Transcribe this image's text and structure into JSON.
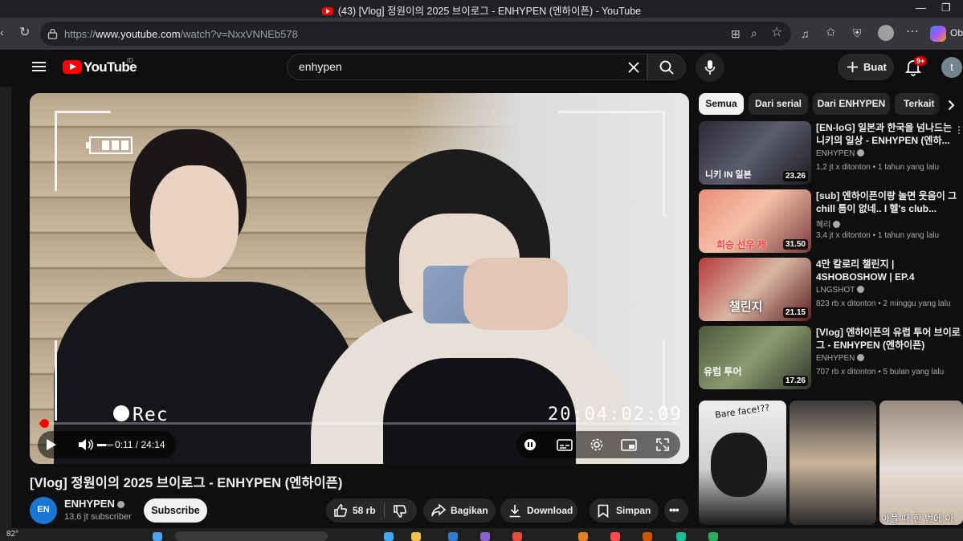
{
  "window": {
    "title": "(43) [Vlog] 정원이의 2025 브이로그 - ENHYPEN (엔하이픈) - YouTube",
    "url_prefix": "https://",
    "url_host": "www.youtube.com",
    "url_path": "/watch?v=NxxVNNEb578",
    "copilot_label": "Ob"
  },
  "header": {
    "logo_text": "YouTube",
    "logo_country": "ID",
    "search_value": "enhypen",
    "create_label": "Buat",
    "notification_count": "9+",
    "avatar_initial": "t"
  },
  "player": {
    "rec_label": "Rec",
    "timecode": "20:04:02:09",
    "current_time": "0:11",
    "duration": "24:14",
    "time_display": "0:11 / 24:14",
    "progress_fraction": 0.0076,
    "volume_fraction": 0.55
  },
  "video": {
    "title": "[Vlog] 정원이의 2025 브이로그 - ENHYPEN (엔하이픈)",
    "channel_name": "ENHYPEN",
    "channel_logo": "EN",
    "subscribers": "13,6 jt subscriber",
    "subscribe_label": "Subscribe",
    "likes": "58 rb",
    "share_label": "Bagikan",
    "download_label": "Download",
    "save_label": "Simpan"
  },
  "sidebar": {
    "chips": [
      "Semua",
      "Dari serial",
      "Dari ENHYPEN",
      "Terkait"
    ],
    "items": [
      {
        "title": "[EN-loG] 일본과 한국을 넘나드는 니키의 일상 - ENHYPEN (엔하...",
        "channel": "ENHYPEN",
        "meta": "1,2 jt x ditonton • 1 tahun yang lalu",
        "duration": "23.26",
        "thumb_text": "니키 IN 일본"
      },
      {
        "title": "[sub] 엔하이픈이랑 놀면 웃음이 그chill 틈이 없네.. l 헬's club...",
        "channel": "혜리",
        "meta": "3,4 jt x ditonton • 1 tahun yang lalu",
        "duration": "31.50",
        "thumb_text": "희승 선우 제"
      },
      {
        "title": "4만 칼로리 챌린지 | 4SHOBOSHOW | EP.4",
        "channel": "LNGSHOT",
        "meta": "823 rb x ditonton • 2 minggu yang lalu",
        "duration": "21.15",
        "thumb_text": "챌린지"
      },
      {
        "title": "[Vlog] 엔하이픈의 유럽 투어 브이로그 - ENHYPEN (엔하이픈)",
        "channel": "ENHYPEN",
        "meta": "707 rb x ditonton • 5 bulan yang lalu",
        "duration": "17.26",
        "thumb_text": "유럽 투어"
      }
    ],
    "shorts": [
      {
        "caption": "Bare face!??"
      },
      {
        "caption": ""
      },
      {
        "caption": "아플 때 한 번에 아"
      }
    ]
  },
  "taskbar": {
    "temperature": "82°"
  },
  "colors": {
    "youtube_red": "#ff0000",
    "background": "#0f0f0f",
    "surface": "#272727"
  }
}
